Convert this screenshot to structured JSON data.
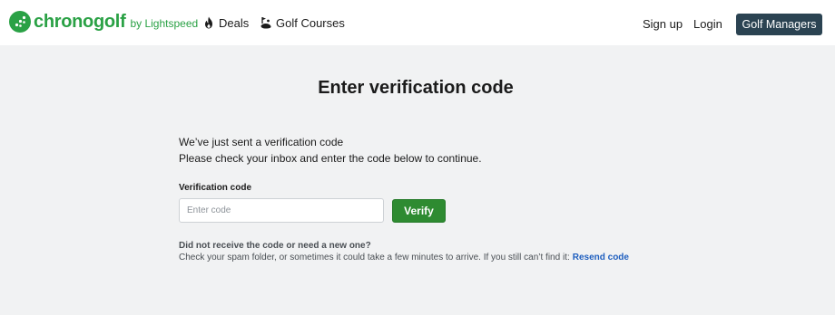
{
  "header": {
    "logo_text": "chronogolf",
    "logo_sub": "by Lightspeed",
    "nav": [
      {
        "label": "Deals",
        "icon": "fire-icon"
      },
      {
        "label": "Golf Courses",
        "icon": "golf-course-icon"
      }
    ],
    "signup_label": "Sign up",
    "login_label": "Login",
    "managers_label": "Golf Managers"
  },
  "page": {
    "title": "Enter verification code",
    "intro_line1": "We’ve just sent a verification code",
    "intro_line2": "Please check your inbox and enter the code below to continue.",
    "field_label": "Verification code",
    "input_placeholder": "Enter code",
    "input_value": "",
    "verify_label": "Verify",
    "help_title": "Did not receive the code or need a new one?",
    "help_text": "Check your spam folder, or sometimes it could take a few minutes to arrive. If you still can’t find it:",
    "resend_label": "Resend code"
  },
  "colors": {
    "brand_green": "#2aa145",
    "verify_green": "#2e8b31",
    "managers_bg": "#2b4352",
    "link_blue": "#1f5fbf",
    "page_bg": "#f1f2f3"
  }
}
